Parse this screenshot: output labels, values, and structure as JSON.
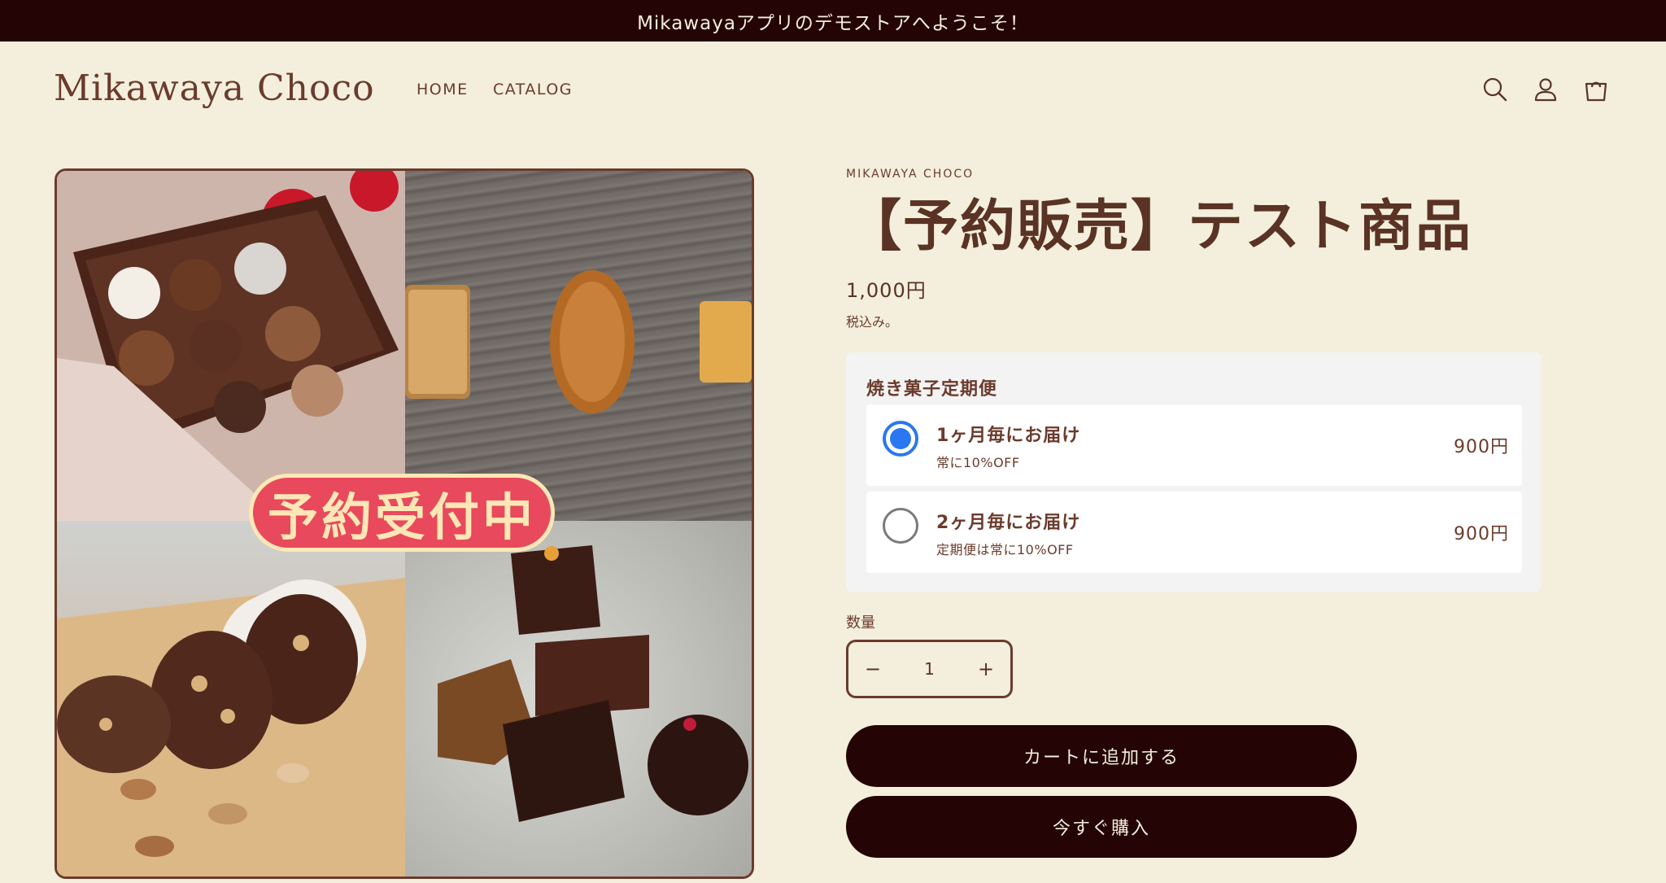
{
  "announcement": "Mikawayaアプリのデモストアへようこそ！",
  "header": {
    "logo": "Mikawaya Choco",
    "nav": [
      "HOME",
      "CATALOG"
    ],
    "icons": [
      "search-icon",
      "account-icon",
      "cart-icon"
    ]
  },
  "media": {
    "badge": "予約受付中"
  },
  "product": {
    "vendor": "MIKAWAYA CHOCO",
    "title": "【予約販売】テスト商品",
    "price": "1,000円",
    "tax_note": "税込み。"
  },
  "subscription": {
    "title": "焼き菓子定期便",
    "selected_index": 0,
    "plans": [
      {
        "name": "1ヶ月毎にお届け",
        "note": "常に10%OFF",
        "price": "900円"
      },
      {
        "name": "2ヶ月毎にお届け",
        "note": "定期便は常に10%OFF",
        "price": "900円"
      }
    ]
  },
  "quantity": {
    "label": "数量",
    "minus": "−",
    "value": "1",
    "plus": "+"
  },
  "buttons": {
    "add_to_cart": "カートに追加する",
    "buy_now": "今すぐ購入"
  },
  "colors": {
    "background": "#f3efdc",
    "brand_dark": "#240405",
    "text_brown": "#6b3b2c",
    "radio_selected": "#2b77f0"
  }
}
